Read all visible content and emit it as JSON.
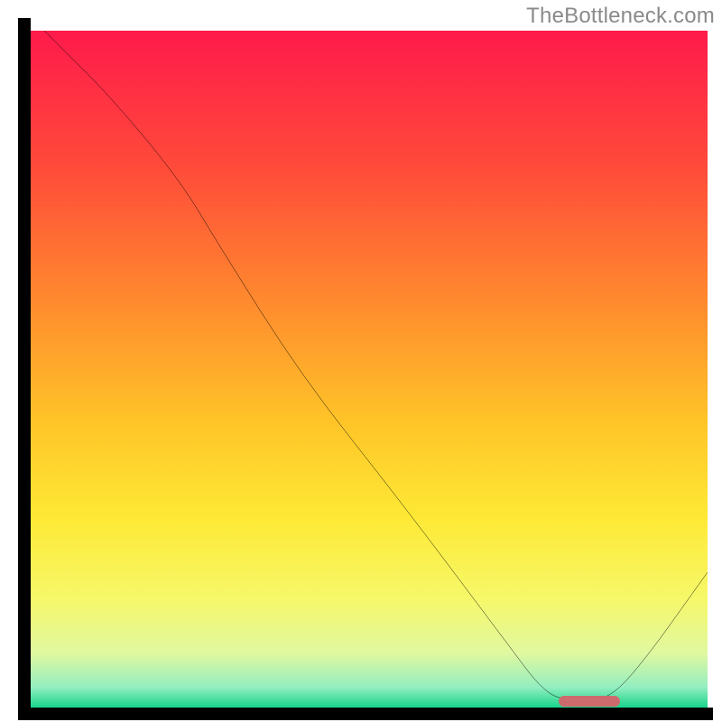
{
  "watermark": "TheBottleneck.com",
  "colors": {
    "gradient_stops": [
      {
        "offset": 0.0,
        "color": "#ff1a4b"
      },
      {
        "offset": 0.2,
        "color": "#ff4a3a"
      },
      {
        "offset": 0.4,
        "color": "#ff8a2e"
      },
      {
        "offset": 0.58,
        "color": "#ffc528"
      },
      {
        "offset": 0.72,
        "color": "#fee935"
      },
      {
        "offset": 0.84,
        "color": "#f6f86a"
      },
      {
        "offset": 0.92,
        "color": "#e0f8a0"
      },
      {
        "offset": 0.97,
        "color": "#93eec0"
      },
      {
        "offset": 1.0,
        "color": "#17d58b"
      }
    ],
    "curve": "#000000",
    "axis": "#000000",
    "marker": "#cd6a6d"
  },
  "chart_data": {
    "type": "line",
    "title": "",
    "xlabel": "",
    "ylabel": "",
    "xlim": [
      0,
      100
    ],
    "ylim": [
      0,
      100
    ],
    "x": [
      0,
      5,
      12,
      22,
      28,
      40,
      55,
      70,
      76,
      80,
      85,
      90,
      100
    ],
    "values": [
      102,
      97,
      90,
      78,
      68,
      49,
      30,
      10,
      2,
      1,
      1,
      6,
      20
    ],
    "marker": {
      "x_start": 78,
      "x_end": 87,
      "y": 1
    },
    "annotations": []
  }
}
